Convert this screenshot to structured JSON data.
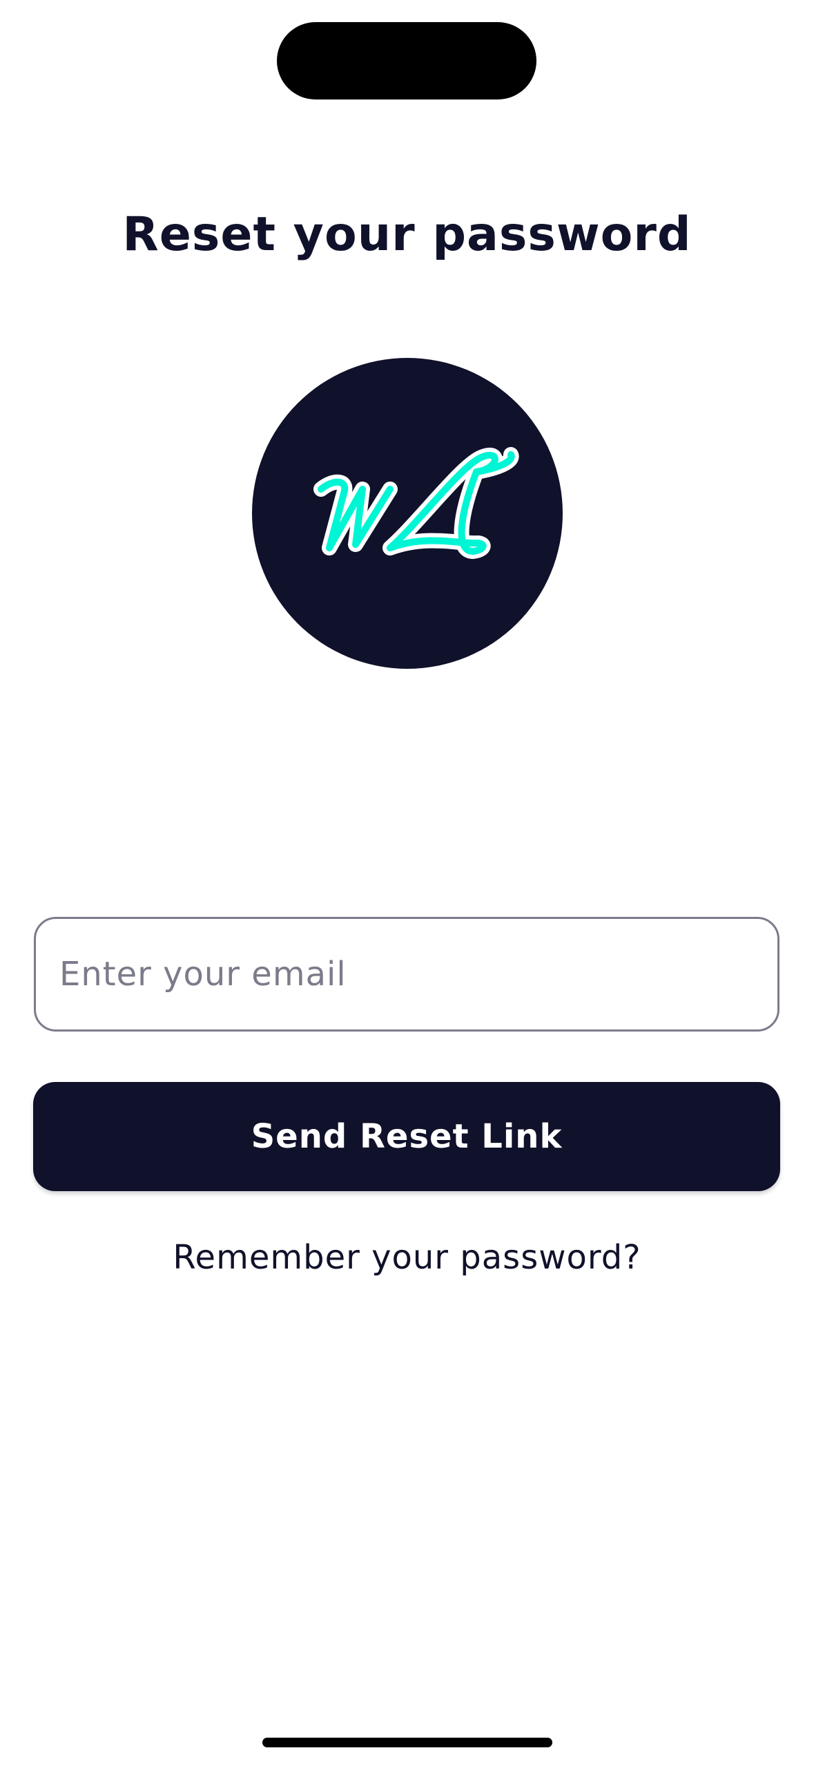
{
  "page": {
    "title": "Reset your password"
  },
  "logo": {
    "icon": "wl-monogram-logo",
    "background_color": "#10112a",
    "accent_color": "#00f5d4"
  },
  "form": {
    "email_placeholder": "Enter your email",
    "email_value": "",
    "submit_label": "Send Reset Link",
    "remember_link_label": "Remember your password?"
  },
  "colors": {
    "primary": "#10112a",
    "border": "#7b7b8a",
    "placeholder": "#7b7b8a",
    "background": "#ffffff"
  }
}
